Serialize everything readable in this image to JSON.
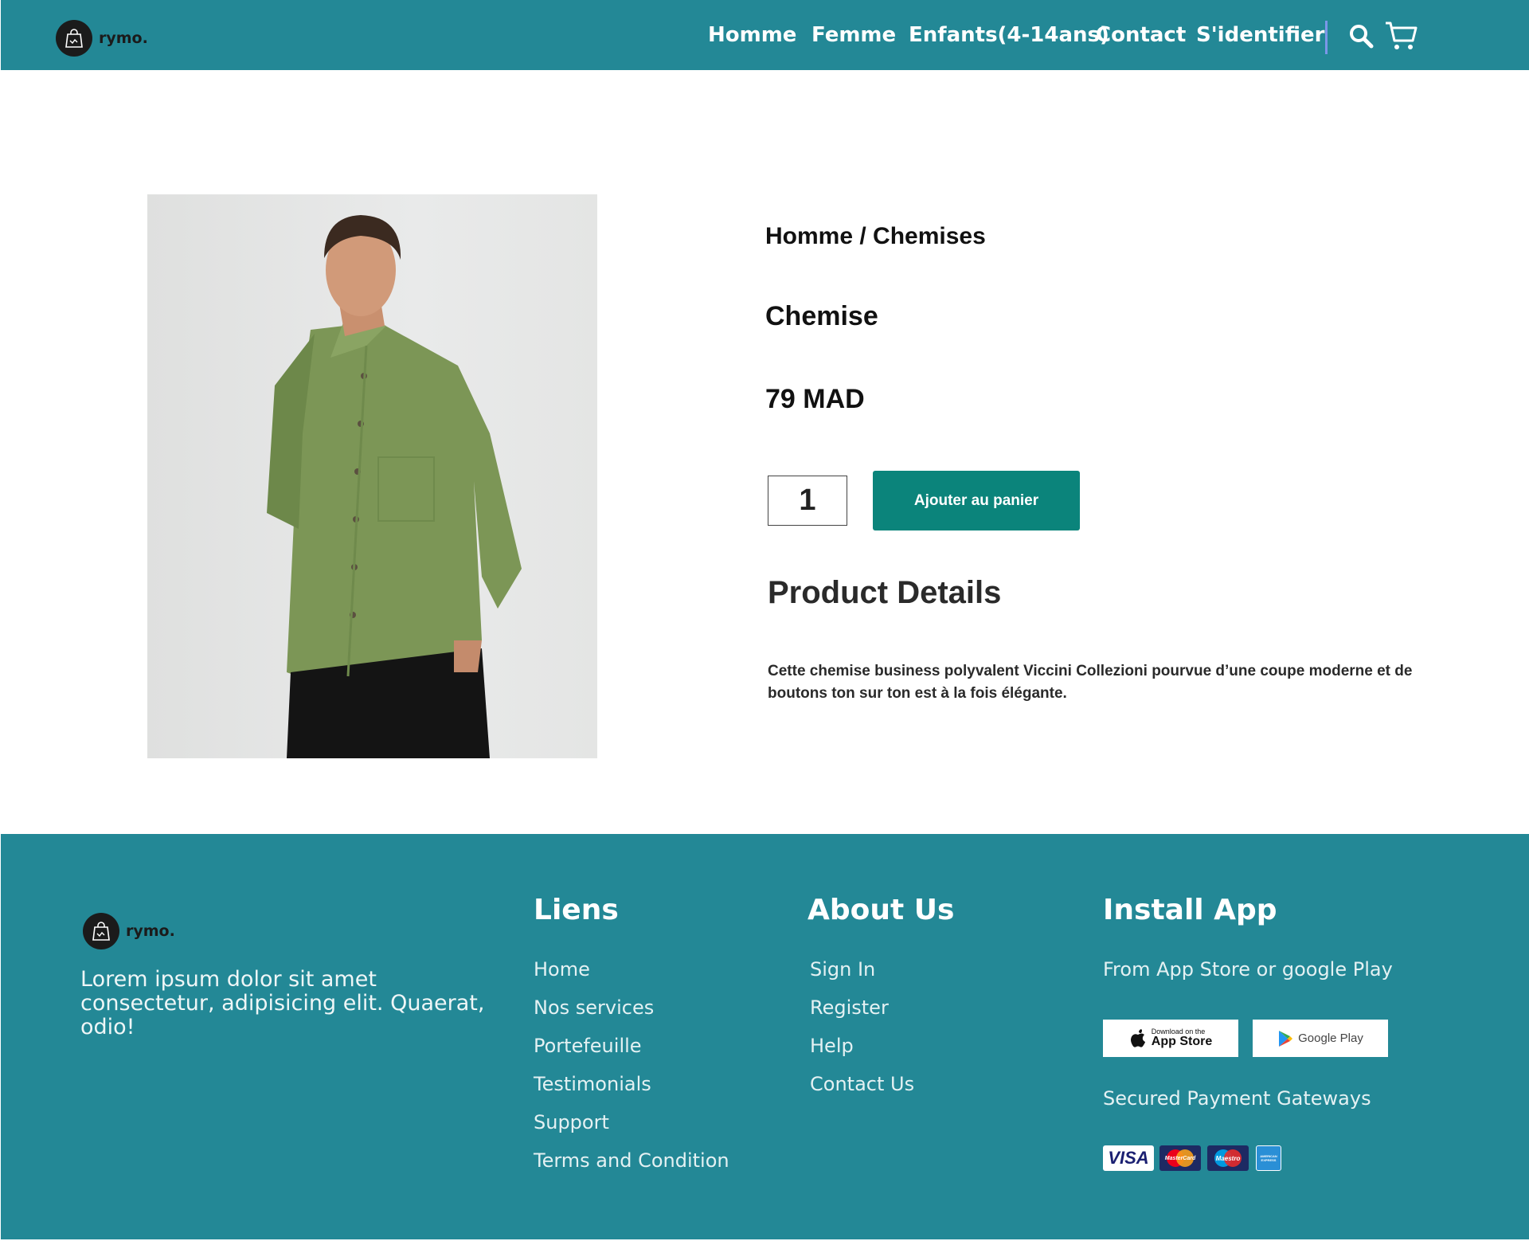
{
  "header": {
    "brand": "rymo.",
    "nav": [
      {
        "label": "Homme"
      },
      {
        "label": "Femme"
      },
      {
        "label": "Enfants(4-14ans)"
      },
      {
        "label": "Contact"
      },
      {
        "label": "S'identifier"
      }
    ],
    "icons": {
      "search": "search-icon",
      "cart": "cart-icon"
    }
  },
  "product": {
    "image": "man-in-green-shirt",
    "breadcrumb": "Homme / Chemises",
    "title": "Chemise",
    "price": "79 MAD",
    "quantity": "1",
    "add_to_cart": "Ajouter au panier",
    "details_heading": "Product Details",
    "details_text": "Cette chemise business polyvalent Viccini Collezioni pourvue d’une coupe moderne et de boutons ton sur ton est à la fois élégante."
  },
  "footer": {
    "brand": "rymo.",
    "description": "Lorem ipsum dolor sit amet consectetur, adipisicing elit. Quaerat, odio!",
    "liens": {
      "title": "Liens",
      "items": [
        "Home",
        "Nos services",
        "Portefeuille",
        "Testimonials",
        "Support",
        "Terms and Condition"
      ]
    },
    "about": {
      "title": "About Us",
      "items": [
        "Sign In",
        "Register",
        "Help",
        "Contact Us"
      ]
    },
    "install": {
      "title": "Install App",
      "subtitle": "From App Store or google Play",
      "app_store_small": "Download on the",
      "app_store": "App Store",
      "google_play": "Google Play",
      "payments_label": "Secured Payment Gateways",
      "payment_cards": [
        "VISA",
        "MasterCard",
        "Maestro",
        "AMERICAN EXPRESS"
      ]
    }
  },
  "colors": {
    "header_bg": "#238896",
    "footer_bg": "#238896",
    "button_bg": "#0b847b",
    "shirt": "#7c9656"
  }
}
